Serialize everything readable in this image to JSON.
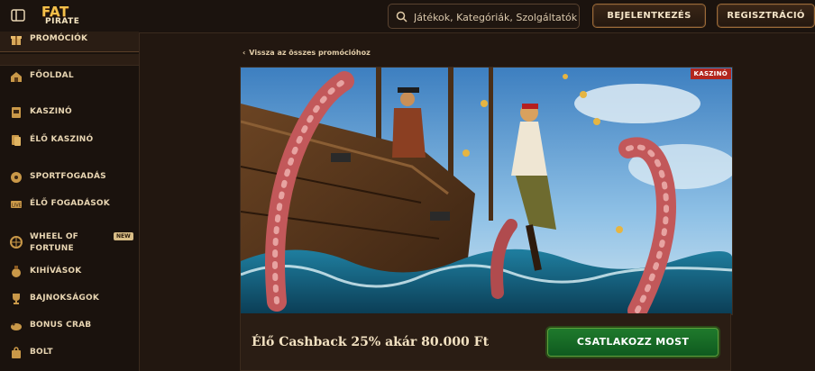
{
  "header": {
    "logo_line1": "FAT",
    "logo_line2": "PIRATE",
    "search_placeholder": "Játékok, Kategóriák, Szolgáltatók",
    "login_label": "BEJELENTKEZÉS",
    "register_label": "REGISZTRÁCIÓ"
  },
  "sidebar": {
    "items": [
      {
        "label": "PROMÓCIÓK",
        "icon": "gift-icon"
      },
      {
        "label": "FŐOLDAL",
        "icon": "home-icon"
      },
      {
        "label": "KASZINÓ",
        "icon": "slot-icon"
      },
      {
        "label": "ÉLŐ KASZINÓ",
        "icon": "cards-icon"
      },
      {
        "label": "SPORTFOGADÁS",
        "icon": "ball-icon"
      },
      {
        "label": "ÉLŐ FOGADÁSOK",
        "icon": "live-icon"
      },
      {
        "label": "WHEEL OF FORTUNE",
        "icon": "wheel-icon",
        "badge": "NEW"
      },
      {
        "label": "KIHÍVÁSOK",
        "icon": "medal-icon"
      },
      {
        "label": "BAJNOKSÁGOK",
        "icon": "trophy-icon"
      },
      {
        "label": "BONUS CRAB",
        "icon": "crab-icon"
      },
      {
        "label": "BOLT",
        "icon": "bag-icon"
      }
    ]
  },
  "main": {
    "back_label": "Vissza az összes promócióhoz",
    "banner_tag": "KASZINÓ",
    "promo_title": "Élő Cashback 25% akár 80.000 Ft",
    "join_label": "CSATLAKOZZ MOST"
  },
  "colors": {
    "background": "#1d140f",
    "accent_gold": "#f3c04a",
    "join_green": "#1f7a2c",
    "tag_red": "#b3261e"
  }
}
